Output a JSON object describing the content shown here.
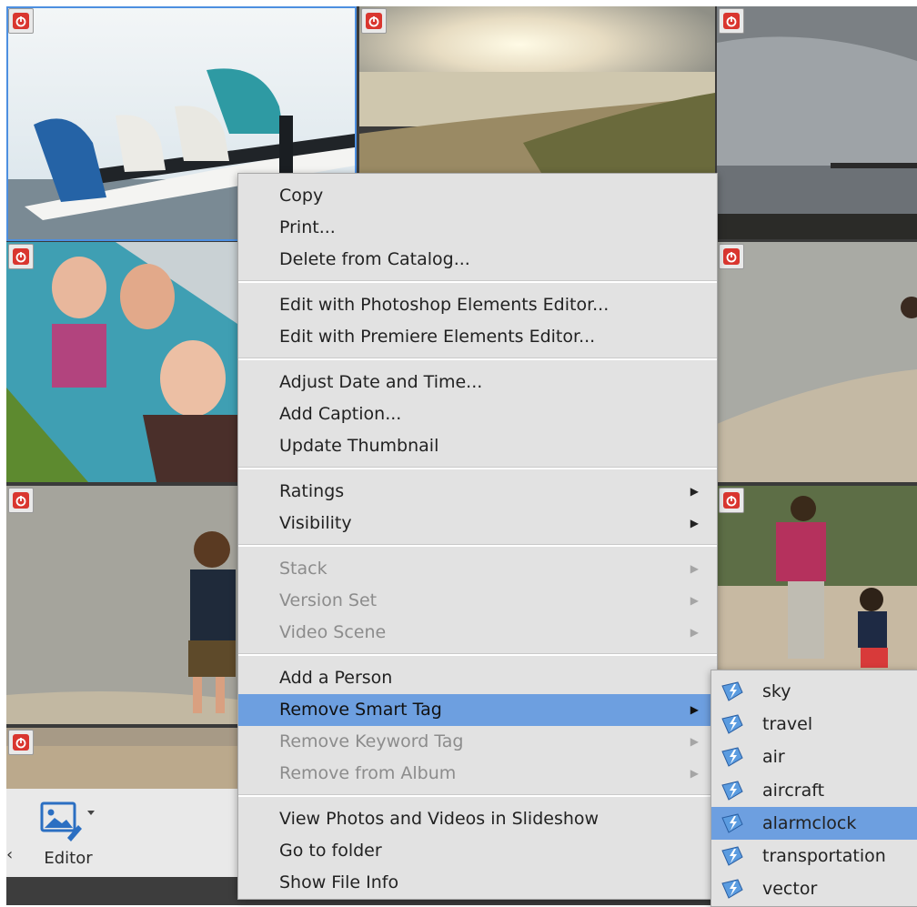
{
  "context_menu": {
    "groups": [
      {
        "items": [
          {
            "label": "Copy",
            "enabled": true
          },
          {
            "label": "Print...",
            "enabled": true
          },
          {
            "label": "Delete from Catalog...",
            "enabled": true
          }
        ]
      },
      {
        "items": [
          {
            "label": "Edit with Photoshop Elements Editor...",
            "enabled": true
          },
          {
            "label": "Edit with Premiere Elements Editor...",
            "enabled": true
          }
        ]
      },
      {
        "items": [
          {
            "label": "Adjust Date and Time...",
            "enabled": true
          },
          {
            "label": "Add Caption...",
            "enabled": true
          },
          {
            "label": "Update Thumbnail",
            "enabled": true
          }
        ]
      },
      {
        "items": [
          {
            "label": "Ratings",
            "enabled": true,
            "submenu": true
          },
          {
            "label": "Visibility",
            "enabled": true,
            "submenu": true
          }
        ]
      },
      {
        "items": [
          {
            "label": "Stack",
            "enabled": false,
            "submenu": true
          },
          {
            "label": "Version Set",
            "enabled": false,
            "submenu": true
          },
          {
            "label": "Video Scene",
            "enabled": false,
            "submenu": true
          }
        ]
      },
      {
        "items": [
          {
            "label": "Add a Person",
            "enabled": true
          },
          {
            "label": "Remove Smart Tag",
            "enabled": true,
            "submenu": true,
            "highlighted": true
          },
          {
            "label": "Remove Keyword Tag",
            "enabled": false,
            "submenu": true
          },
          {
            "label": "Remove from Album",
            "enabled": false,
            "submenu": true
          }
        ]
      },
      {
        "items": [
          {
            "label": "View Photos and Videos in Slideshow",
            "enabled": true
          },
          {
            "label": "Go to folder",
            "enabled": true
          },
          {
            "label": "Show File Info",
            "enabled": true
          }
        ]
      }
    ]
  },
  "smart_tag_submenu": {
    "items": [
      {
        "label": "sky"
      },
      {
        "label": "travel"
      },
      {
        "label": "air"
      },
      {
        "label": "aircraft"
      },
      {
        "label": "alarmclock",
        "highlighted": true
      },
      {
        "label": "transportation"
      },
      {
        "label": "vector"
      }
    ]
  },
  "toolbar": {
    "editor_label": "Editor",
    "back_glyph": "‹"
  },
  "colors": {
    "menu_bg": "#e2e2e2",
    "highlight": "#6d9fe0",
    "selection_border": "#4d8fe0",
    "badge_red": "#d9362f"
  }
}
